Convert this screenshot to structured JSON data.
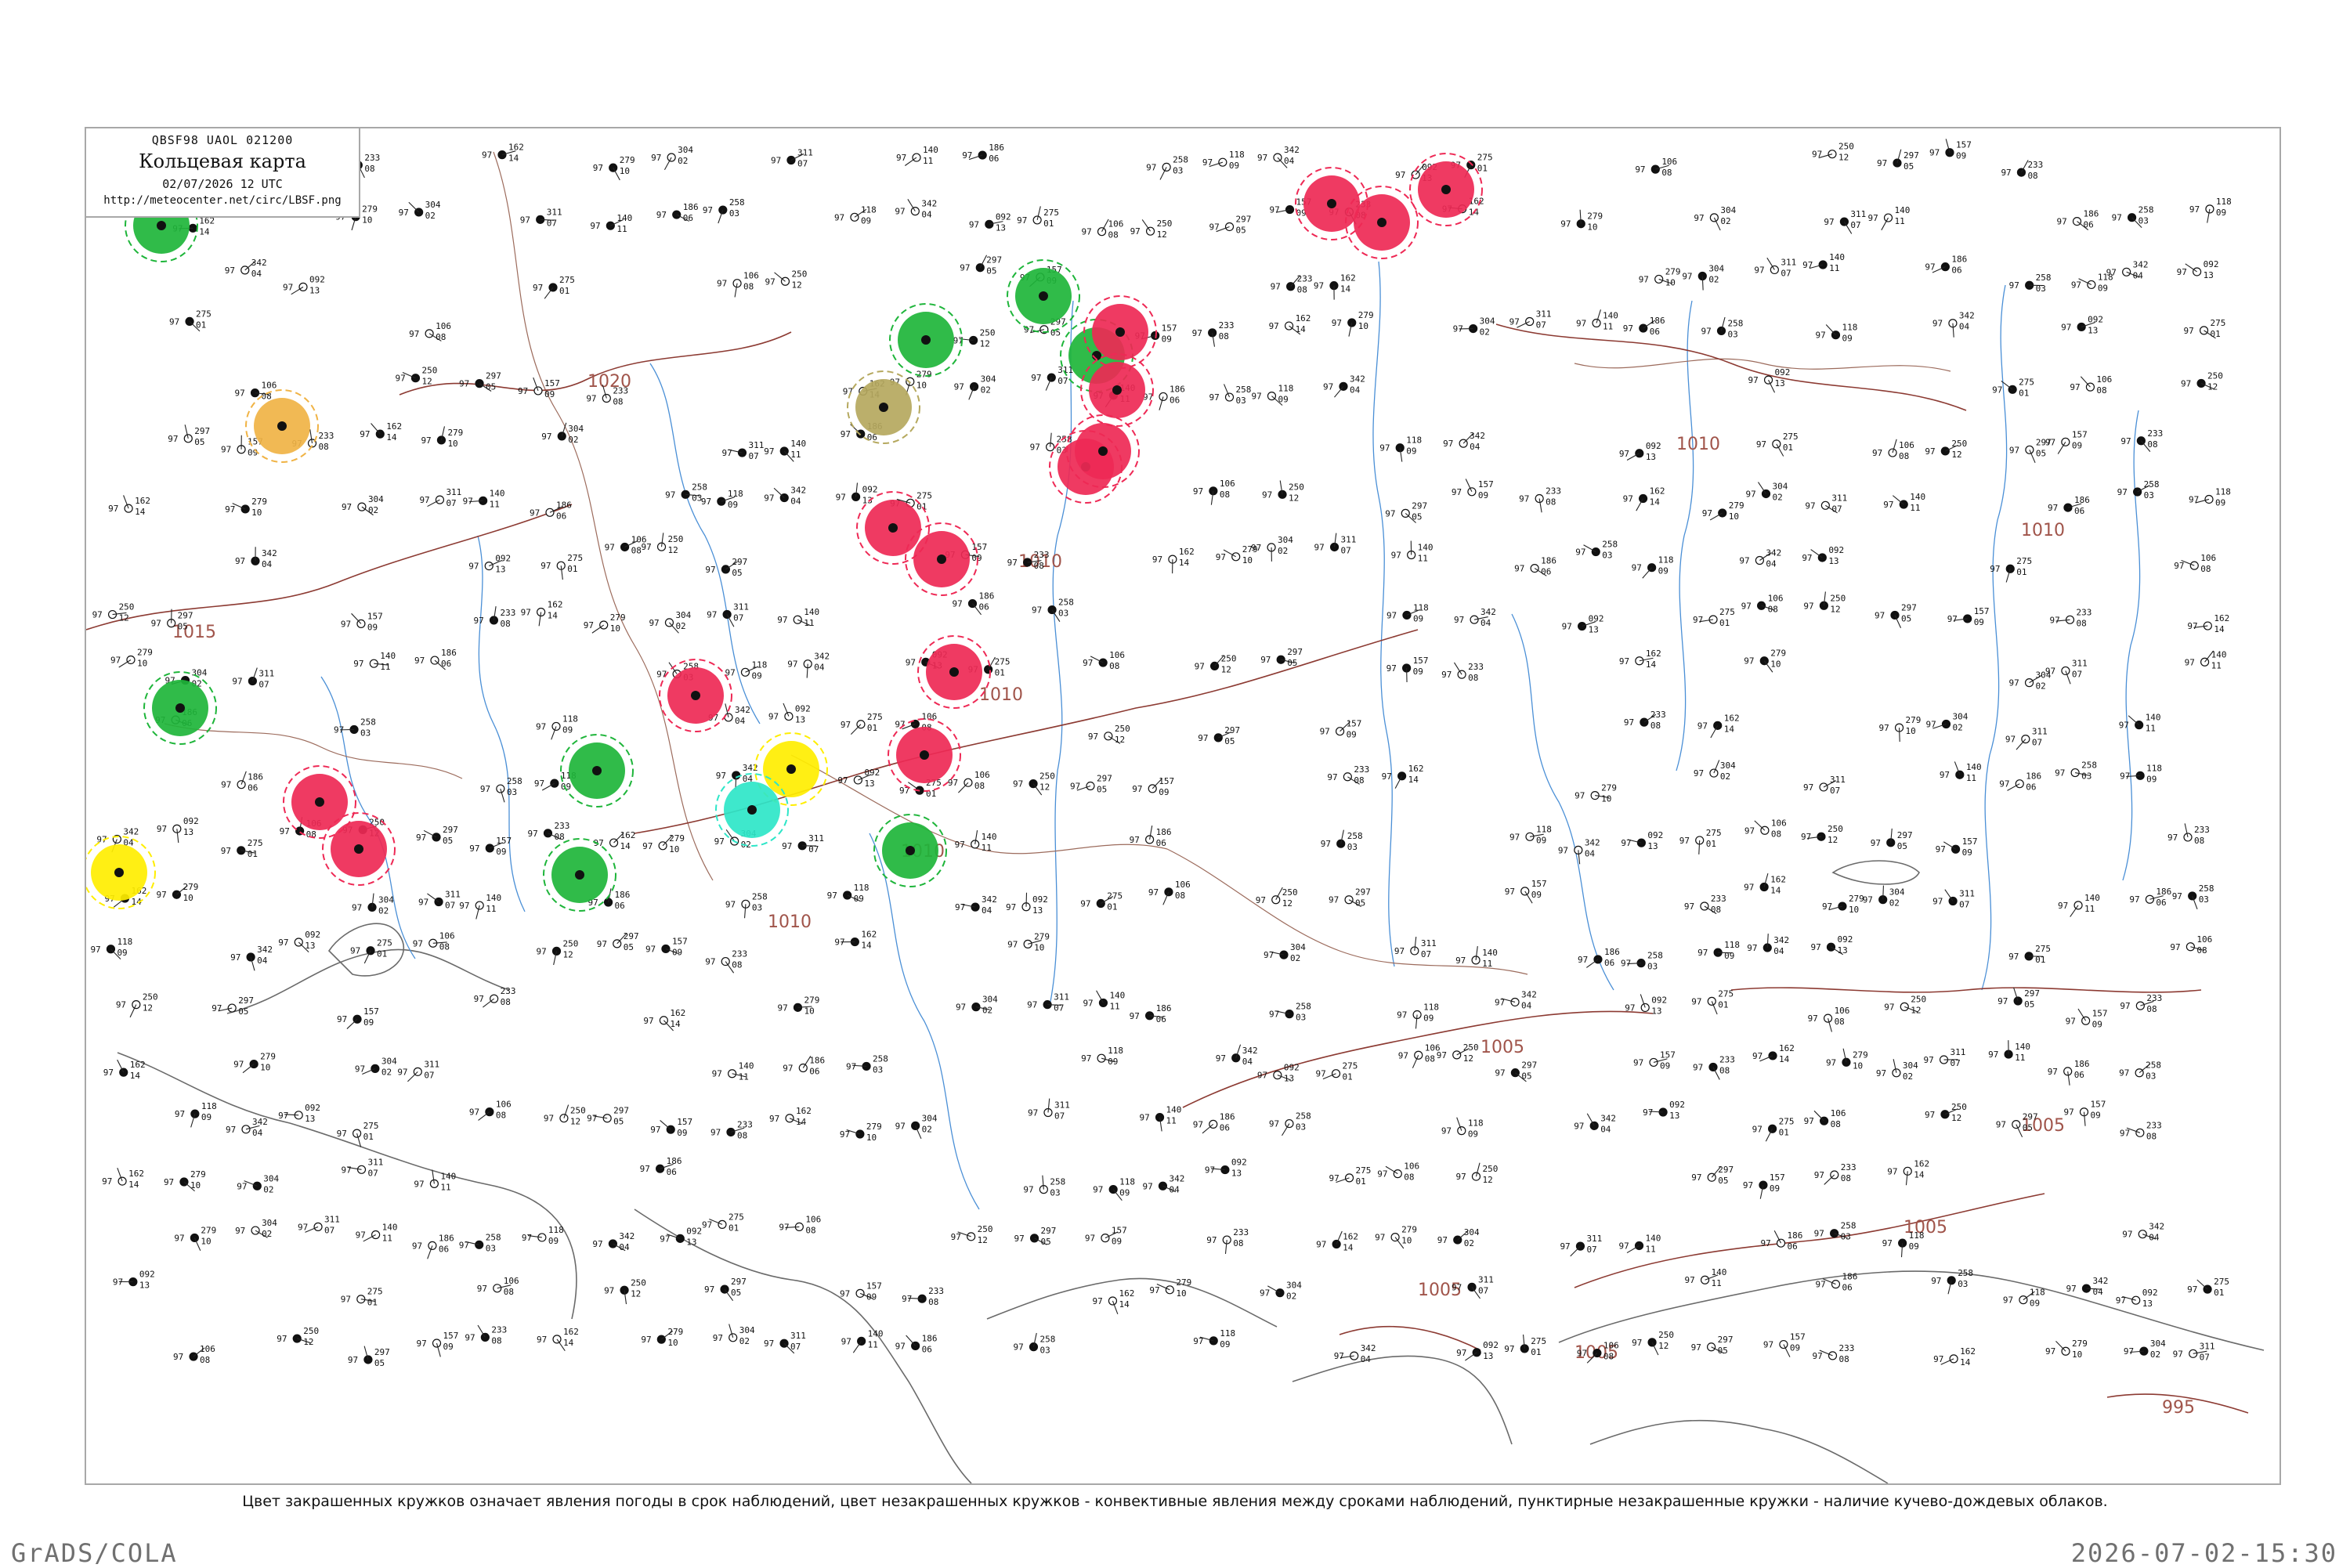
{
  "header": {
    "code_line": "QBSF98  UAOL  021200",
    "title": "Кольцевая карта",
    "date": "02/07/2026 12 UTC",
    "url": "http://meteocenter.net/circ/LBSF.png"
  },
  "caption": "Цвет закрашенных кружков означает явления погоды в срок наблюдений, цвет незакрашенных кружков - конвективные явления между сроками наблюдений, пунктирные незакрашенные кружки - наличие кучево-дождевых облаков.",
  "footer": {
    "left": "GrADS/COLA",
    "right": "2026-07-02-15:30"
  },
  "colors": {
    "frame": "#a8a8a8",
    "isobar": "#8c3a32",
    "river": "#4a8fd6",
    "coast": "#555555",
    "thunderstorm": "#ee2955",
    "rain": "#1eb53a",
    "shower": "#ffee00",
    "drizzle": "#2ee6c8",
    "haze": "#b5a85e",
    "dust": "#f0b345"
  },
  "isobar_labels": [
    "1015",
    "1020",
    "1010",
    "1010",
    "1010",
    "1010",
    "1010",
    "1010",
    "1005",
    "1005",
    "1005",
    "1005",
    "1005",
    "995"
  ],
  "fill_circles": [
    {
      "type": "rain",
      "color": "#1eb53a"
    },
    {
      "type": "rain",
      "color": "#1eb53a"
    },
    {
      "type": "rain",
      "color": "#1eb53a"
    },
    {
      "type": "rain",
      "color": "#1eb53a"
    },
    {
      "type": "rain",
      "color": "#1eb53a"
    },
    {
      "type": "rain",
      "color": "#1eb53a"
    },
    {
      "type": "rain",
      "color": "#1eb53a"
    },
    {
      "type": "rain",
      "color": "#1eb53a"
    },
    {
      "type": "thunderstorm",
      "color": "#ee2955"
    },
    {
      "type": "thunderstorm",
      "color": "#ee2955"
    },
    {
      "type": "thunderstorm",
      "color": "#ee2955"
    },
    {
      "type": "thunderstorm",
      "color": "#ee2955"
    },
    {
      "type": "thunderstorm",
      "color": "#ee2955"
    },
    {
      "type": "thunderstorm",
      "color": "#ee2955"
    },
    {
      "type": "thunderstorm",
      "color": "#ee2955"
    },
    {
      "type": "thunderstorm",
      "color": "#ee2955"
    },
    {
      "type": "thunderstorm",
      "color": "#ee2955"
    },
    {
      "type": "thunderstorm",
      "color": "#ee2955"
    },
    {
      "type": "thunderstorm",
      "color": "#ee2955"
    },
    {
      "type": "thunderstorm",
      "color": "#ee2955"
    },
    {
      "type": "thunderstorm",
      "color": "#ee2955"
    },
    {
      "type": "thunderstorm",
      "color": "#ee2955"
    },
    {
      "type": "shower",
      "color": "#ffee00"
    },
    {
      "type": "shower",
      "color": "#ffee00"
    },
    {
      "type": "drizzle",
      "color": "#2ee6c8"
    },
    {
      "type": "haze",
      "color": "#b5a85e"
    },
    {
      "type": "dust",
      "color": "#f0b345"
    }
  ],
  "station_samples": [
    {
      "p": "250",
      "t": "97",
      "d": "12"
    },
    {
      "p": "297",
      "t": "97",
      "d": "05"
    },
    {
      "p": "157",
      "t": "97",
      "d": "09"
    },
    {
      "p": "233",
      "t": "97",
      "d": "08"
    },
    {
      "p": "162",
      "t": "97",
      "d": "14"
    },
    {
      "p": "279",
      "t": "97",
      "d": "10"
    },
    {
      "p": "304",
      "t": "97",
      "d": "02"
    },
    {
      "p": "311",
      "t": "97",
      "d": "07"
    },
    {
      "p": "140",
      "t": "97",
      "d": "11"
    },
    {
      "p": "186",
      "t": "97",
      "d": "06"
    },
    {
      "p": "258",
      "t": "97",
      "d": "03"
    },
    {
      "p": "118",
      "t": "97",
      "d": "09"
    },
    {
      "p": "342",
      "t": "97",
      "d": "04"
    },
    {
      "p": "092",
      "t": "97",
      "d": "13"
    },
    {
      "p": "275",
      "t": "97",
      "d": "01"
    },
    {
      "p": "106",
      "t": "97",
      "d": "08"
    }
  ]
}
